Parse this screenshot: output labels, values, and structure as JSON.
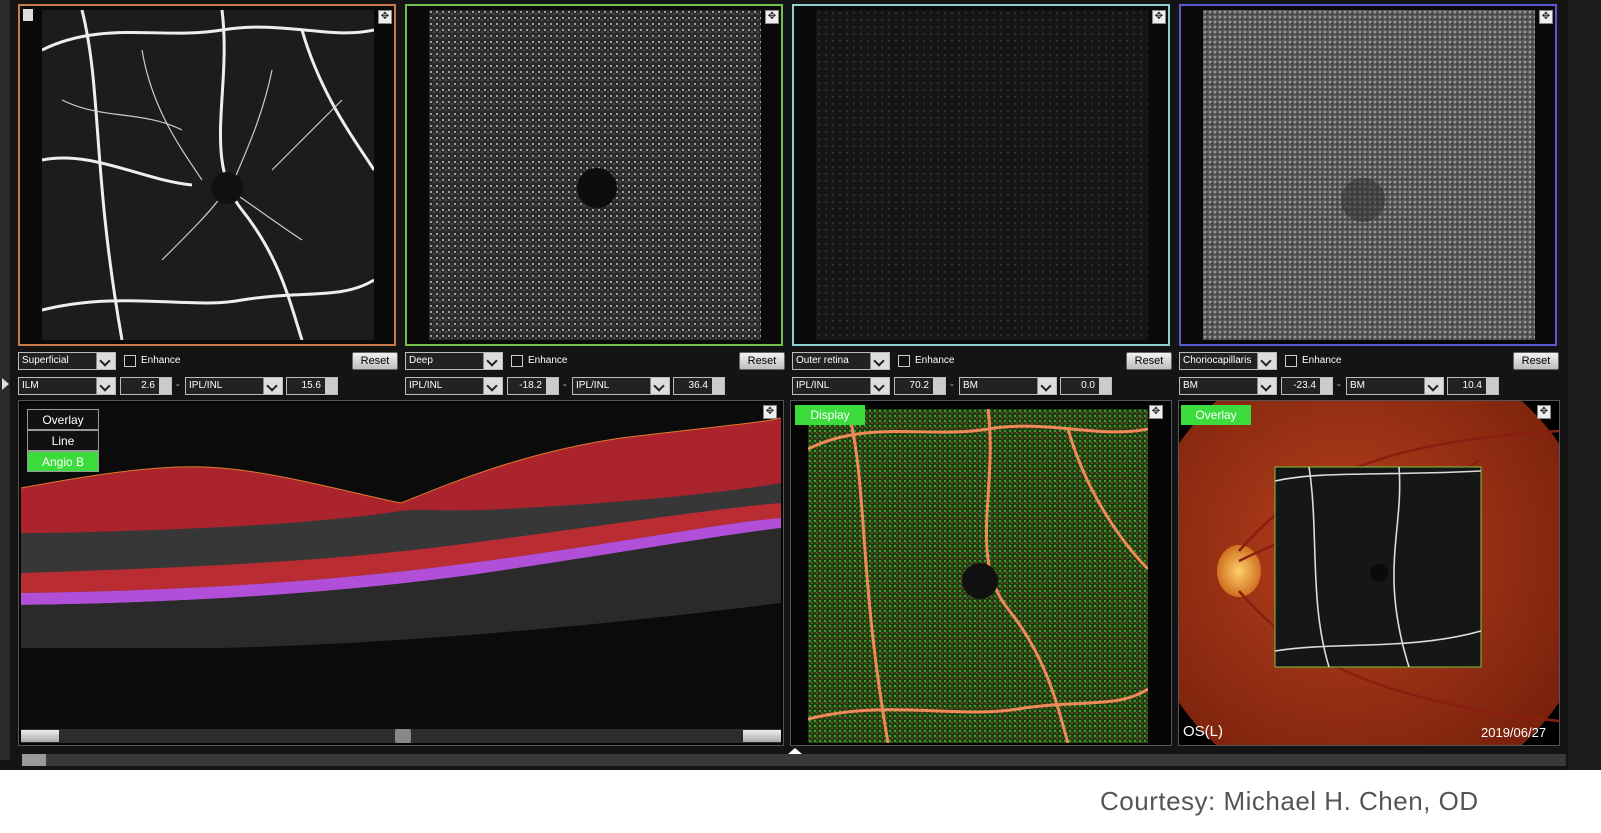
{
  "panels": [
    {
      "slab": "Superficial",
      "enhance": "Enhance",
      "reset": "Reset",
      "upper": "ILM",
      "upper_val": "2.6",
      "lower": "IPL/INL",
      "lower_val": "15.6",
      "border": "#c87a4a"
    },
    {
      "slab": "Deep",
      "enhance": "Enhance",
      "reset": "Reset",
      "upper": "IPL/INL",
      "upper_val": "-18.2",
      "lower": "IPL/INL",
      "lower_val": "36.4",
      "border": "#6fbf4a"
    },
    {
      "slab": "Outer retina",
      "enhance": "Enhance",
      "reset": "Reset",
      "upper": "IPL/INL",
      "upper_val": "70.2",
      "lower": "BM",
      "lower_val": "0.0",
      "border": "#8ecfcf"
    },
    {
      "slab": "Choriocapillaris",
      "enhance": "Enhance",
      "reset": "Reset",
      "upper": "BM",
      "upper_val": "-23.4",
      "lower": "BM",
      "lower_val": "10.4",
      "border": "#5a5ad0"
    }
  ],
  "separator": "-",
  "bscan": {
    "modes": [
      "Overlay",
      "Line",
      "Angio B"
    ],
    "active_mode": "Angio B"
  },
  "middle": {
    "button": "Display"
  },
  "fundus": {
    "button": "Overlay",
    "eye": "OS(L)",
    "date": "2019/06/27"
  },
  "colors": {
    "accent_green": "#3cdc3c",
    "background": "#141414"
  },
  "icons": [
    "expand-icon",
    "document-icon",
    "scroll-left-icon",
    "scroll-right-icon"
  ],
  "courtesy": "Courtesy: Michael H. Chen, OD"
}
